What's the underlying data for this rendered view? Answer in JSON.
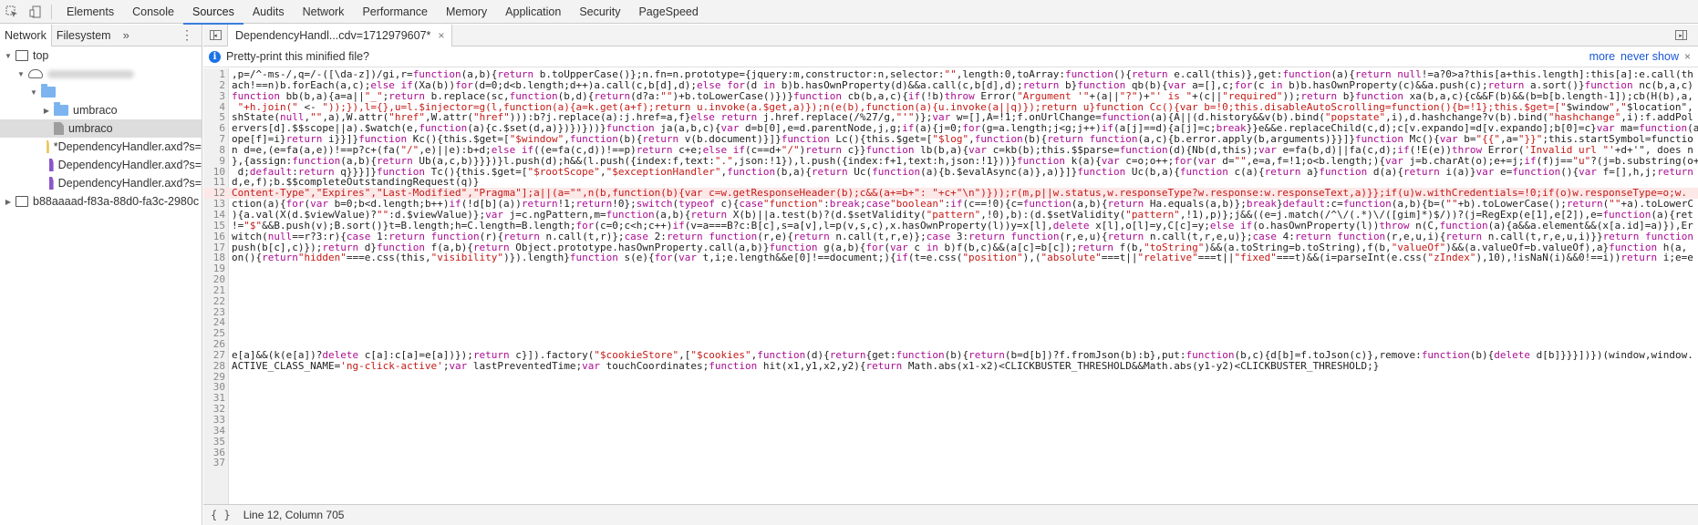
{
  "devtools_tabs": [
    {
      "label": "Elements",
      "active": false
    },
    {
      "label": "Console",
      "active": false
    },
    {
      "label": "Sources",
      "active": true
    },
    {
      "label": "Audits",
      "active": false
    },
    {
      "label": "Network",
      "active": false
    },
    {
      "label": "Performance",
      "active": false
    },
    {
      "label": "Memory",
      "active": false
    },
    {
      "label": "Application",
      "active": false
    },
    {
      "label": "Security",
      "active": false
    },
    {
      "label": "PageSpeed",
      "active": false
    }
  ],
  "navigator": {
    "tabs": [
      "Network",
      "Filesystem"
    ],
    "more_label": "»",
    "tree": [
      {
        "label": "top",
        "icon": "frame-icon",
        "expanded": true,
        "depth": 0
      },
      {
        "label": "",
        "icon": "cloud-icon",
        "expanded": true,
        "depth": 1,
        "blurred": true
      },
      {
        "label": "",
        "icon": "folder-icon",
        "expanded": true,
        "depth": 2
      },
      {
        "label": "umbraco",
        "icon": "folder-icon",
        "expanded": false,
        "depth": 3
      },
      {
        "label": "umbraco",
        "icon": "file-icon",
        "color": "#9e9e9e",
        "depth": 3,
        "selected": true
      },
      {
        "label": "*DependencyHandler.axd?s=",
        "icon": "file-icon",
        "color": "#e8c14b",
        "depth": 3
      },
      {
        "label": "DependencyHandler.axd?s=",
        "icon": "file-icon",
        "color": "#8a56c8",
        "depth": 3
      },
      {
        "label": "DependencyHandler.axd?s=",
        "icon": "file-icon",
        "color": "#8a56c8",
        "depth": 3
      },
      {
        "label": "b88aaaad-f83a-88d0-fa3c-2980c",
        "icon": "frame-icon",
        "expanded": false,
        "depth": 0
      }
    ]
  },
  "editor": {
    "open_tab": "DependencyHandl...cdv=1712979607*",
    "infobar": {
      "message": "Pretty-print this minified file?",
      "more": "more",
      "never_show": "never show"
    },
    "highlighted_line": 12,
    "lines": [
      ",p=/^-ms-/,q=/-([\\da-z])/gi,r=function(a,b){return b.toUpperCase()};n.fn=n.prototype={jquery:m,constructor:n,selector:\"\",length:0,toArray:function(){return e.call(this)},get:function(a){return null!=a?0>a?this[a+this.length]:this[a]:e.call(th",
      "ach!==n)b.forEach(a,c);else if(Xa(b))for(d=0;d<b.length;d++)a.call(c,b[d],d);else for(d in b)b.hasOwnProperty(d)&&a.call(c,b[d],d);return b}function qb(b){var a=[],c;for(c in b)b.hasOwnProperty(c)&&a.push(c);return a.sort()}function nc(b,a,c)",
      "function bb(b,a){a=a||\"_\";return b.replace(sc,function(b,d){return(d?a:\"\")+b.toLowerCase()})}function cb(b,a,c){if(!b)throw Error(\"Argument '\"+(a||\"?\")+\"' is \"+(c||\"required\"));return b}function xa(b,a,c){c&&F(b)&&(b=b[b.length-1]);cb(H(b),a,",
      " \"+h.join(\" <- \"));}),l={},u=l.$injector=g(l,function(a){a=k.get(a+f);return u.invoke(a.$get,a)});n(e(b),function(a){u.invoke(a||q)});return u}function Cc(){var b=!0;this.disableAutoScrolling=function(){b=!1};this.$get=[\"$window\",\"$location\",",
      "shState(null,\"\",a),W.attr(\"href\",W.attr(\"href\"))):b?j.replace(a):j.href=a,f}else return j.href.replace(/%27/g,\"'\")};var w=[],A=!1;f.onUrlChange=function(a){A||(d.history&&v(b).bind(\"popstate\",i),d.hashchange?v(b).bind(\"hashchange\",i):f.addPol",
      "ervers[d].$$scope||a).$watch(e,function(a){c.$set(d,a)})})}))}function ja(a,b,c){var d=b[0],e=d.parentNode,j,g;if(a){j=0;for(g=a.length;j<g;j++)if(a[j]==d){a[j]=c;break}}e&&e.replaceChild(c,d);c[v.expando]=d[v.expando];b[0]=c}var ma=function(a",
      "ope[f]=i}return i}}]}function Kc(){this.$get=[\"$window\",function(b){return v(b.document)}]}function Lc(){this.$get=[\"$log\",function(b){return function(a,c){b.error.apply(b,arguments)}}]}function Mc(){var b=\"{{\",a=\"}}\";this.startSymbol=functio",
      "n d=e,(e=fa(a,e))!==p?c+(fa(\"/\",e)||e):b+d;else if((e=fa(c,d))!==p)return c+e;else if(c==d+\"/\")return c}}function lb(b,a){var c=kb(b);this.$$parse=function(d){Nb(d,this);var e=fa(b,d)||fa(c,d);if(!E(e))throw Error('Invalid url \"'+d+'\", does n",
      "},{assign:function(a,b){return Ub(a,c,b)}}})}l.push(d);h&&(l.push({index:f,text:\".\",json:!1}),l.push({index:f+1,text:h,json:!1}))}function k(a){var c=o;o++;for(var d=\"\",e=a,f=!1;o<b.length;){var j=b.charAt(o);e+=j;if(f)j==\"u\"?(j=b.substring(o+",
      " d;default:return q}}}]}function Tc(){this.$get=[\"$rootScope\",\"$exceptionHandler\",function(b,a){return Uc(function(a){b.$evalAsync(a)},a)}]}function Uc(b,a){function c(a){return a}function d(a){return i(a)}var e=function(){var f=[],h,j;return",
      "d,e,f);b.$$completeOutstandingRequest(q)}",
      "Content-Type\",\"Expires\",\"Last-Modified\",\"Pragma\"];a||(a=\"\",n(b,function(b){var c=w.getResponseHeader(b);c&&(a+=b+\": \"+c+\"\\n\")}));r(m,p||w.status,w.responseType?w.response:w.responseText,a)}};if(u)w.withCredentials=!0;if(o)w.responseType=o;w.",
      "ction(a){for(var b=0;b<d.length;b++)if(!d[b](a))return!1;return!0};switch(typeof c){case\"function\":break;case\"boolean\":if(c==!0){c=function(a,b){return Ha.equals(a,b)};break}default:c=function(a,b){b=(\"\"+b).toLowerCase();return(\"\"+a).toLowerC",
      "){a.val(X(d.$viewValue)?\"\":d.$viewValue)};var j=c.ngPattern,m=function(a,b){return X(b)||a.test(b)?(d.$setValidity(\"pattern\",!0),b):(d.$setValidity(\"pattern\",!1),p)};j&&((e=j.match(/^\\/(.*)\\/([gim]*)$/))?(j=RegExp(e[1],e[2]),e=function(a){ret",
      "!=\"$\"&&B.push(v);B.sort()}t=B.length;h=C.length=B.length;for(c=0;c<h;c++)if(v=a===B?c:B[c],s=a[v],l=p(v,s,c),x.hasOwnProperty(l))y=x[l],delete x[l],o[l]=y,C[c]=y;else if(o.hasOwnProperty(l))throw n(C,function(a){a&&a.element&&(x[a.id]=a)}),Er",
      "witch(null==r?3:r){case 1:return function(r){return n.call(t,r)};case 2:return function(r,e){return n.call(t,r,e)};case 3:return function(r,e,u){return n.call(t,r,e,u)};case 4:return function(r,e,u,i){return n.call(t,r,e,u,i)}}return function",
      "push(b[c],c)});return d}function f(a,b){return Object.prototype.hasOwnProperty.call(a,b)}function g(a,b){for(var c in b)f(b,c)&&(a[c]=b[c]);return f(b,\"toString\")&&(a.toString=b.toString),f(b,\"valueOf\")&&(a.valueOf=b.valueOf),a}function h(a,",
      "on(){return\"hidden\"===e.css(this,\"visibility\")}).length}function s(e){for(var t,i;e.length&&e[0]!==document;){if(t=e.css(\"position\"),(\"absolute\"===t||\"relative\"===t||\"fixed\"===t)&&(i=parseInt(e.css(\"zIndex\"),10),!isNaN(i)&&0!==i))return i;e=e",
      "",
      "",
      "",
      "",
      "",
      "",
      "",
      "",
      "e[a]&&(k(e[a])?delete c[a]:c[a]=e[a])});return c}]).factory(\"$cookieStore\",[\"$cookies\",function(d){return{get:function(b){return(b=d[b])?f.fromJson(b):b},put:function(b,c){d[b]=f.toJson(c)},remove:function(b){delete d[b]}}}])})(window,window.",
      "ACTIVE_CLASS_NAME='ng-click-active';var lastPreventedTime;var touchCoordinates;function hit(x1,y1,x2,y2){return Math.abs(x1-x2)<CLICKBUSTER_THRESHOLD&&Math.abs(y1-y2)<CLICKBUSTER_THRESHOLD;}",
      "",
      "",
      "",
      "",
      "",
      "",
      "",
      "",
      ""
    ]
  },
  "status": {
    "pretty_print_icon": "{ }",
    "cursor": "Line 12, Column 705"
  }
}
